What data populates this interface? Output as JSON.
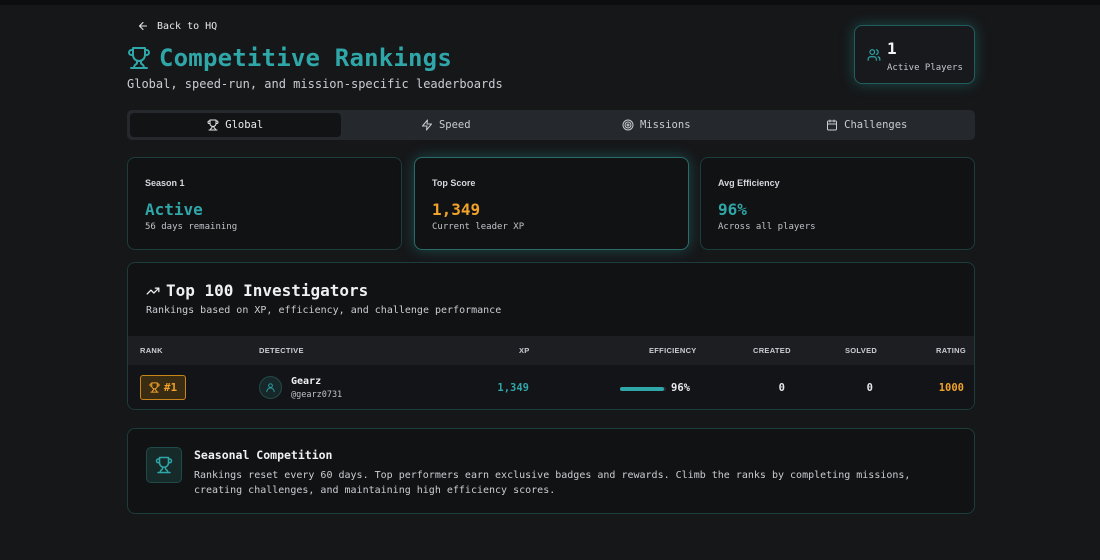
{
  "nav": {
    "back_label": "Back to HQ"
  },
  "header": {
    "title": "Competitive Rankings",
    "subtitle": "Global, speed-run, and mission-specific leaderboards"
  },
  "players": {
    "count": "1",
    "label": "Active Players"
  },
  "tabs": [
    {
      "label": "Global",
      "icon": "trophy-icon",
      "active": true
    },
    {
      "label": "Speed",
      "icon": "lightning-icon",
      "active": false
    },
    {
      "label": "Missions",
      "icon": "target-icon",
      "active": false
    },
    {
      "label": "Challenges",
      "icon": "calendar-icon",
      "active": false
    }
  ],
  "stats": [
    {
      "key": "Season 1",
      "value": "Active",
      "desc": "56 days remaining",
      "color": "#2fa6a8"
    },
    {
      "key": "Top Score",
      "value": "1,349",
      "desc": "Current leader XP",
      "color": "#f0a22a"
    },
    {
      "key": "Avg Efficiency",
      "value": "96%",
      "desc": "Across all players",
      "color": "#2fa6a8"
    }
  ],
  "leaderboard": {
    "title": "Top 100 Investigators",
    "subtitle": "Rankings based on XP, efficiency, and challenge performance",
    "columns": [
      "RANK",
      "DETECTIVE",
      "XP",
      "EFFICIENCY",
      "CREATED",
      "SOLVED",
      "RATING"
    ],
    "rows": [
      {
        "rank": "#1",
        "name": "Gearz",
        "handle": "@gearz0731",
        "xp": "1,349",
        "efficiency": "96%",
        "efficiency_value": 96,
        "created": "0",
        "solved": "0",
        "rating": "1000"
      }
    ]
  },
  "season": {
    "title": "Seasonal Competition",
    "text": "Rankings reset every 60 days. Top performers earn exclusive badges and rewards. Climb the ranks by completing missions, creating challenges, and maintaining high efficiency scores."
  },
  "colors": {
    "accent": "#2fa6a8",
    "gold": "#f0a22a",
    "background": "#161719"
  }
}
